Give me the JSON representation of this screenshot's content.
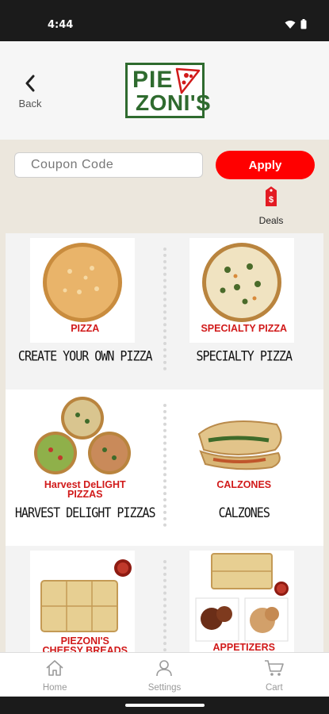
{
  "status_bar": {
    "time": "4:44"
  },
  "header": {
    "back_label": "Back",
    "logo_line1": "PIE",
    "logo_line2": "ZONI'S"
  },
  "coupon": {
    "placeholder": "Coupon Code",
    "apply_label": "Apply"
  },
  "deals": {
    "label": "Deals"
  },
  "menu": [
    {
      "caption": "PIZZA",
      "title": "CREATE YOUR OWN PIZZA"
    },
    {
      "caption": "SPECIALTY PIZZA",
      "title": "SPECIALTY PIZZA"
    },
    {
      "caption_line1": "Harvest DeLIGHT",
      "caption_line2": "PIZZAS",
      "title": "HARVEST DELIGHT PIZZAS"
    },
    {
      "caption": "CALZONES",
      "title": "CALZONES"
    },
    {
      "caption_line1": "PIEZONI'S",
      "caption_line2": "CHEESY BREADS"
    },
    {
      "caption": "APPETIZERS"
    }
  ],
  "bottom_nav": [
    {
      "label": "Home",
      "icon": "home-icon"
    },
    {
      "label": "Settings",
      "icon": "user-icon"
    },
    {
      "label": "Cart",
      "icon": "cart-icon"
    }
  ],
  "colors": {
    "accent": "#ff0000",
    "brand_green": "#2f6b2f",
    "caption_red": "#d11a1a"
  }
}
